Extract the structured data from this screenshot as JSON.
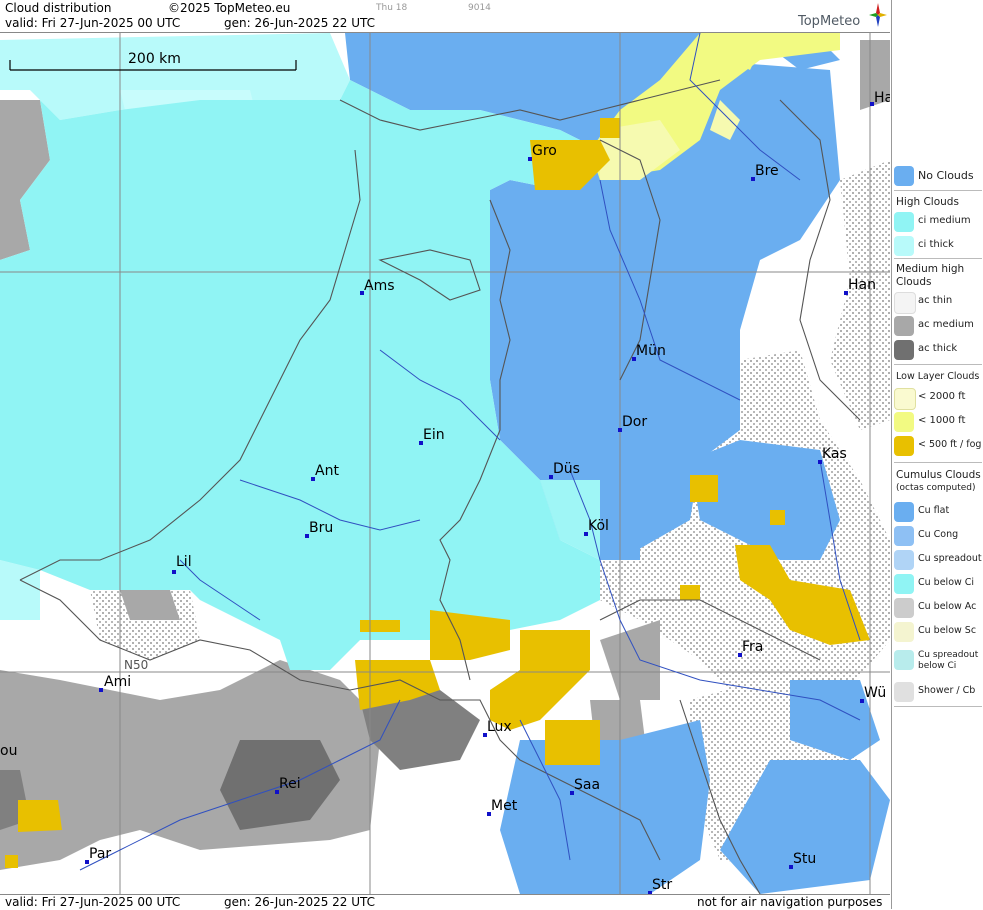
{
  "header": {
    "title": "Cloud distribution",
    "copyright": "©2025 TopMeteo.eu",
    "chip1": "Thu 18",
    "chip2": "9014",
    "valid": "valid:  Fri  27-Jun-2025  00 UTC",
    "gen": "gen: 26-Jun-2025 22 UTC",
    "logo": "TopMeteo"
  },
  "footer": {
    "valid": "valid:  Fri  27-Jun-2025  00 UTC",
    "gen": "gen: 26-Jun-2025 22 UTC",
    "disclaimer": "not for air navigation purposes"
  },
  "map": {
    "scale_label": "200 km",
    "lat_label": "N50",
    "cities": [
      "Ha",
      "Gro",
      "Bre",
      "Ams",
      "Han",
      "Mün",
      "Ein",
      "Dor",
      "Ant",
      "Düs",
      "Kas",
      "Bru",
      "Köl",
      "Lil",
      "Fra",
      "Ami",
      "Lux",
      "Wü",
      "ou",
      "Rei",
      "Saa",
      "Met",
      "Par",
      "Stu",
      "Str"
    ]
  },
  "legend": {
    "no_clouds": "No Clouds",
    "high_head": "High Clouds",
    "ci_medium": "ci medium",
    "ci_thick": "ci thick",
    "mid_head_1": "Medium high",
    "mid_head_2": "Clouds",
    "ac_thin": "ac thin",
    "ac_medium": "ac medium",
    "ac_thick": "ac thick",
    "low_head": "Low Layer Clouds",
    "low_2000": "< 2000 ft",
    "low_1000": "< 1000 ft",
    "low_500": "< 500 ft / fog",
    "cu_head": "Cumulus Clouds",
    "cu_sub": "(octas computed)",
    "cu_flat": "Cu flat",
    "cu_cong": "Cu Cong",
    "cu_spread": "Cu spreadout",
    "cu_below_ci": "Cu below Ci",
    "cu_below_ac": "Cu below Ac",
    "cu_below_sc": "Cu below Sc",
    "cu_spread_ci_1": "Cu spreadout",
    "cu_spread_ci_2": "below Ci",
    "shower": "Shower / Cb"
  },
  "colors": {
    "no_clouds": "#6aaef0",
    "ci_medium": "#90f4f4",
    "ci_thick": "#b8fafa",
    "ac_thin": "#ffffff",
    "ac_medium": "#a8a8a8",
    "ac_thick": "#707070",
    "low_2000": "#fafad0",
    "low_1000": "#f2fa82",
    "low_500": "#e8c000",
    "border": "#555555",
    "river": "#3050c0",
    "grid": "#888888"
  }
}
